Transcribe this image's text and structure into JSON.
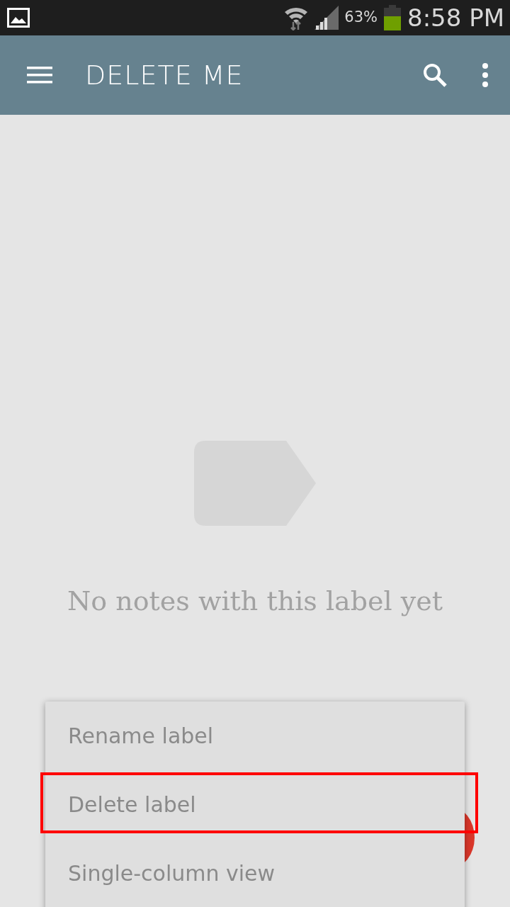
{
  "status_bar": {
    "battery_text": "63%",
    "time": "8:58 PM"
  },
  "toolbar": {
    "title": "DELETE ME"
  },
  "empty_state": {
    "message": "No notes with this label yet"
  },
  "menu": {
    "items": [
      {
        "label": "Rename label",
        "highlighted": false
      },
      {
        "label": "Delete label",
        "highlighted": true
      },
      {
        "label": "Single-column view",
        "highlighted": false
      }
    ]
  }
}
